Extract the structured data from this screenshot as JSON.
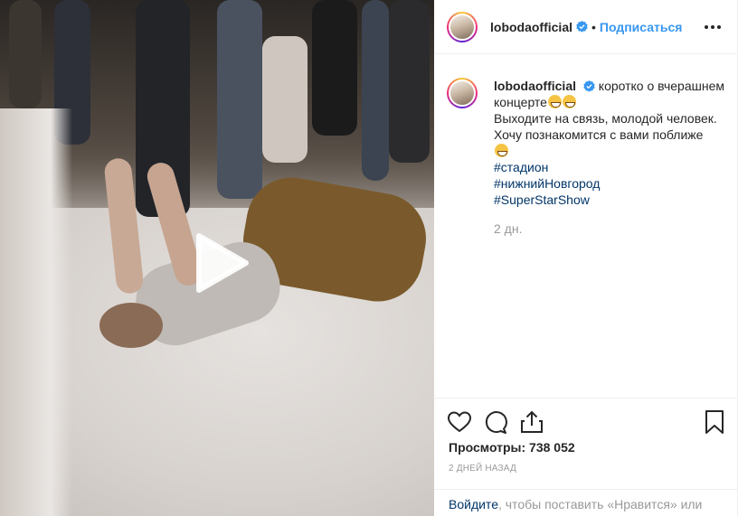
{
  "post": {
    "username": "lobodaofficial",
    "follow_label": "Подписаться",
    "dot": "•"
  },
  "media": {
    "type": "video"
  },
  "caption": {
    "username": "lobodaofficial",
    "line1": "коротко о вчерашнем концерте",
    "line2": "Выходите на связь, молодой человек.",
    "line3": "Хочу познакомится с вами поближе",
    "tags": [
      "#стадион",
      "#нижнийНовгород",
      "#SuperStarShow"
    ],
    "time": "2 дн."
  },
  "actions": {
    "icons": [
      "heart-icon",
      "comment-icon",
      "share-icon",
      "bookmark-icon"
    ],
    "views": "Просмотры: 738 052",
    "date": "2 ДНЕЙ НАЗАД"
  },
  "login": {
    "link_label": "Войдите",
    "text": ", чтобы поставить «Нравится» или прокомментировать."
  },
  "colors": {
    "accent": "#3897f0",
    "verified": "#3897f0",
    "hashtag": "#003569",
    "muted": "#999999"
  }
}
